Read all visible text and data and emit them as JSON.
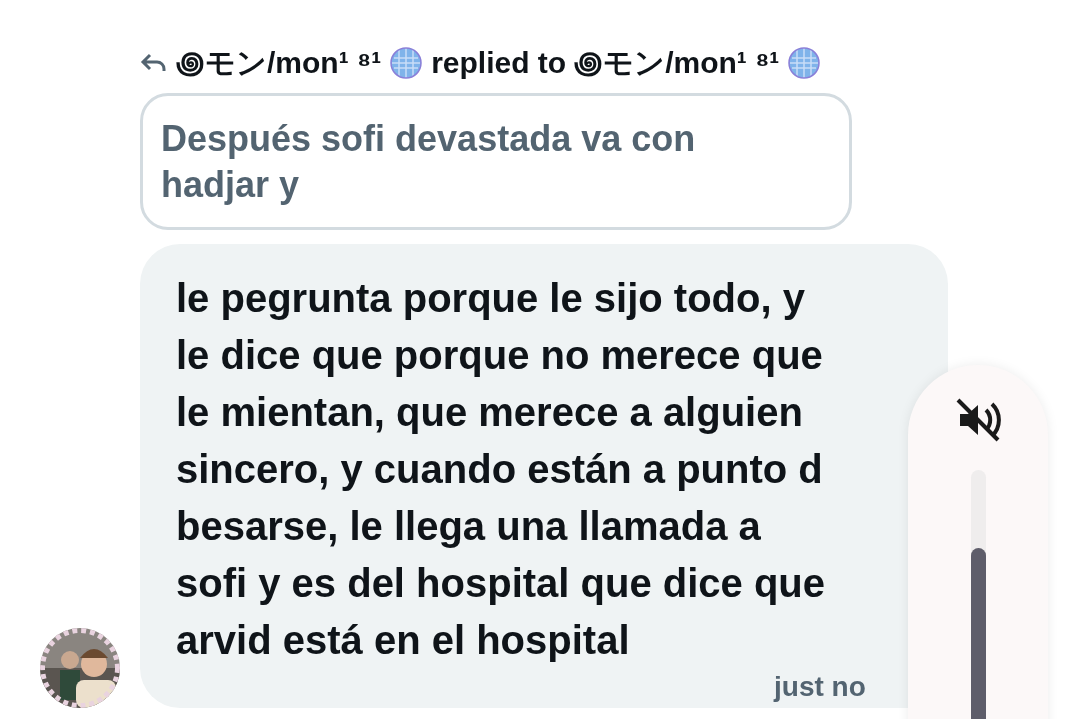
{
  "reply_header": {
    "author": "꩜モン/mon¹ ⁸¹",
    "action": "replied to",
    "target": "꩜モン/mon¹ ⁸¹"
  },
  "quoted_message": {
    "text": "Después sofi devastada va con\nhadjar y"
  },
  "message": {
    "text": "le pegrunta porque le sijo todo, y\nle dice que porque no merece que\nle mientan, que merece a alguien\nsincero, y cuando están a punto d\nbesarse, le llega una llamada a\nsofi y es del hospital que dice que\narvid está en el hospital",
    "time": "just no"
  },
  "volume": {
    "muted": true,
    "level": 0.7
  }
}
